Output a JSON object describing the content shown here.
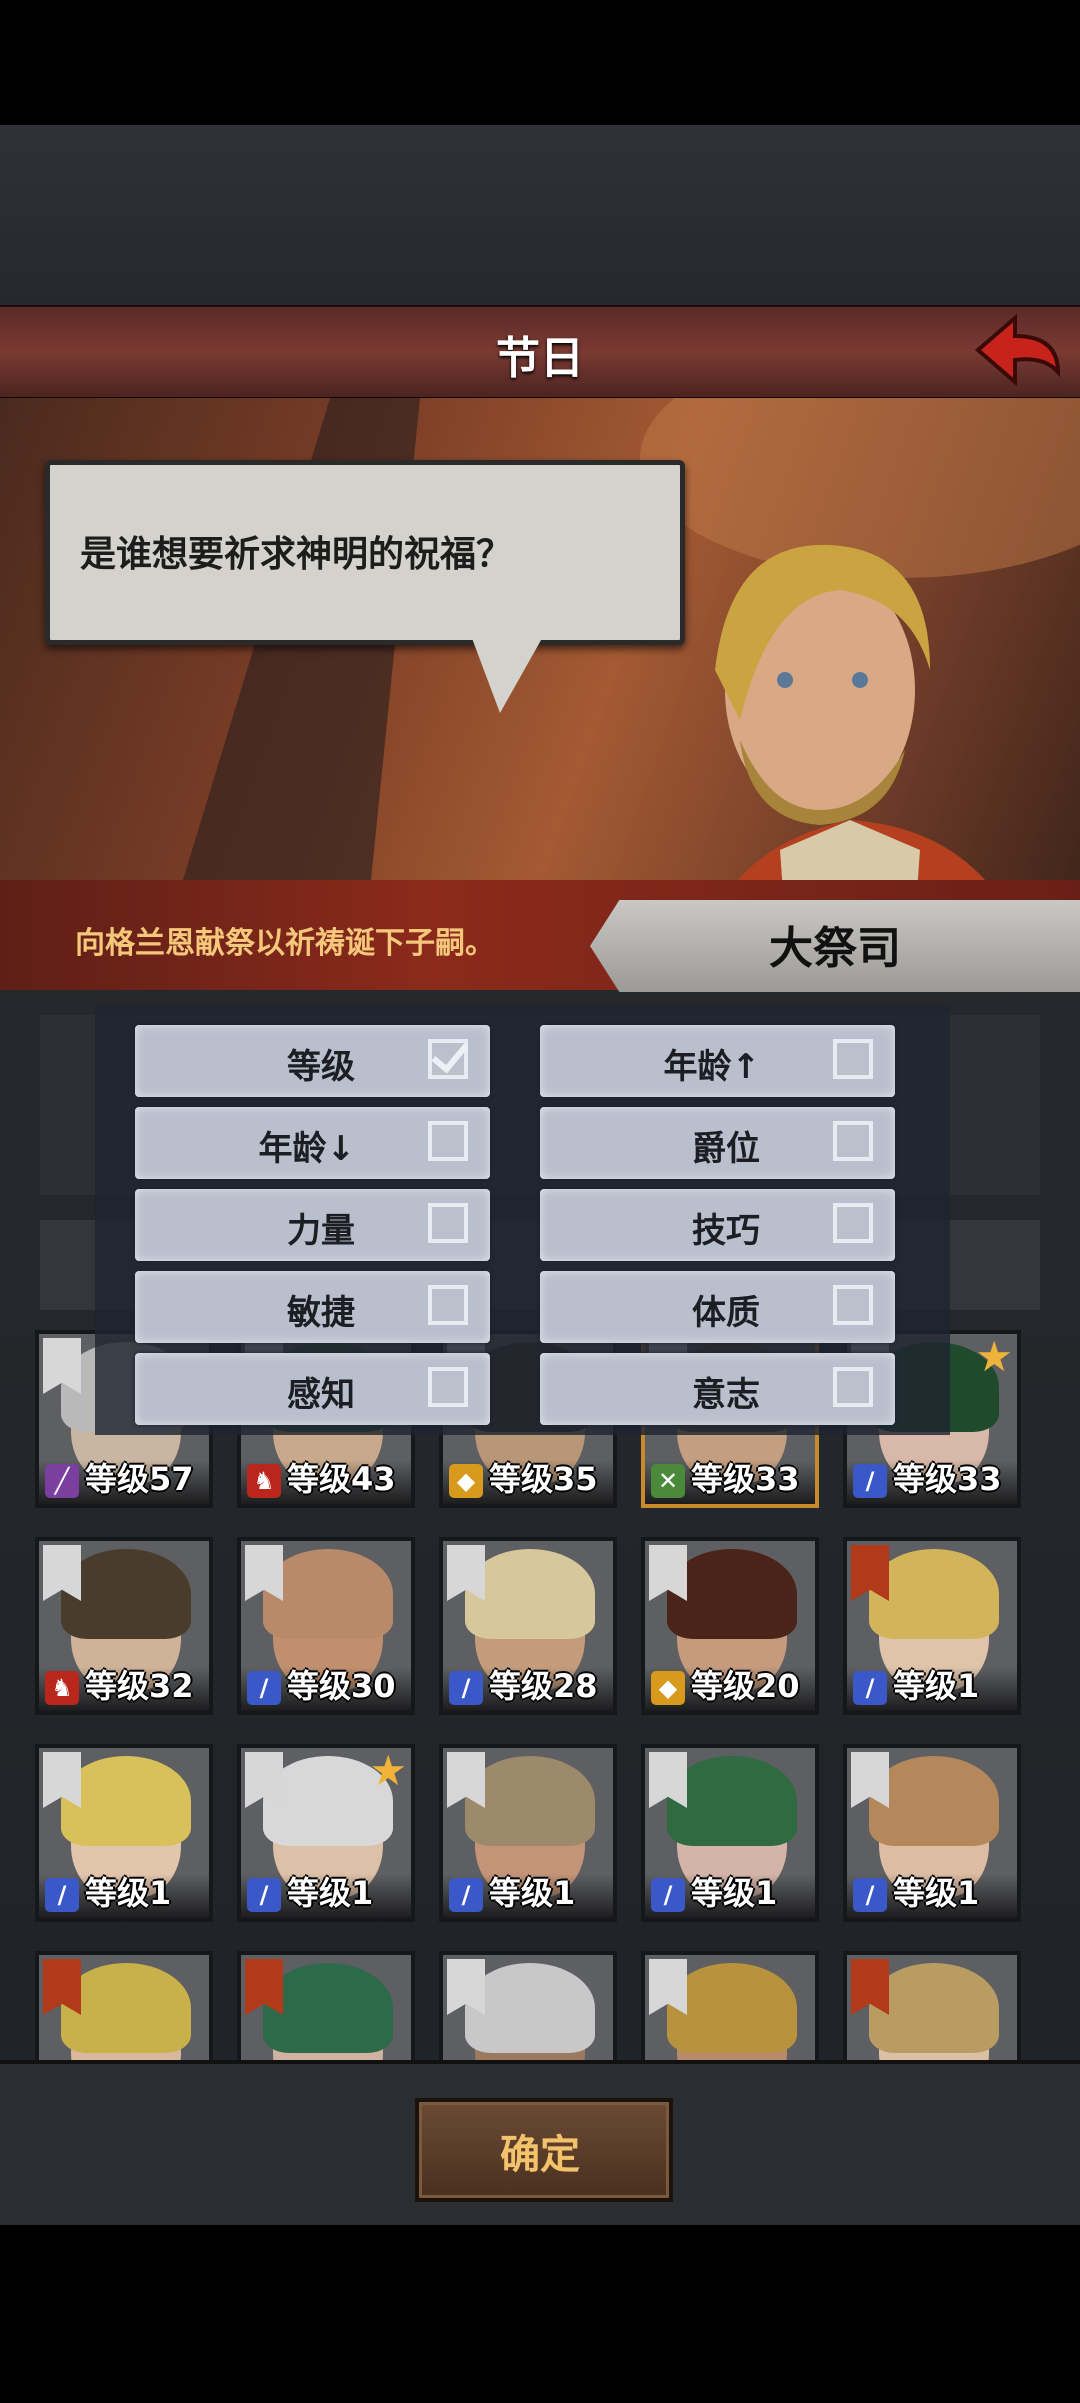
{
  "header": {
    "title": "节日"
  },
  "dialog": {
    "text": "是谁想要祈求神明的祝福？"
  },
  "info": {
    "text": "向格兰恩献祭以祈祷诞下子嗣。",
    "name": "大祭司"
  },
  "sort_options": [
    {
      "label": "等级",
      "checked": true
    },
    {
      "label": "年龄↑",
      "checked": false
    },
    {
      "label": "年龄↓",
      "checked": false
    },
    {
      "label": "爵位",
      "checked": false
    },
    {
      "label": "力量",
      "checked": false
    },
    {
      "label": "技巧",
      "checked": false
    },
    {
      "label": "敏捷",
      "checked": false
    },
    {
      "label": "体质",
      "checked": false
    },
    {
      "label": "感知",
      "checked": false
    },
    {
      "label": "意志",
      "checked": false
    }
  ],
  "characters": [
    {
      "level": "等级57",
      "class": "staff",
      "banner": "white",
      "star": false,
      "hair": "#b9b9b9",
      "skin": "#c9b6a2"
    },
    {
      "level": "等级43",
      "class": "horse",
      "banner": "white",
      "star": false,
      "hair": "#2f5a34",
      "skin": "#c8a98c"
    },
    {
      "level": "等级35",
      "class": "shield",
      "banner": "white",
      "star": false,
      "hair": "#3a3026",
      "skin": "#b89678"
    },
    {
      "level": "等级33",
      "class": "cross",
      "banner": "white",
      "star": false,
      "selected": true,
      "hair": "#5a4a36",
      "skin": "#c49e80"
    },
    {
      "level": "等级33",
      "class": "sword",
      "banner": "white",
      "star": true,
      "hair": "#1f4a2c",
      "skin": "#d8b8a8"
    },
    {
      "level": "等级32",
      "class": "horse",
      "banner": "white",
      "star": false,
      "hair": "#4a3c2c",
      "skin": "#d0b298"
    },
    {
      "level": "等级30",
      "class": "sword",
      "banner": "white",
      "star": false,
      "hair": "#b98a6a",
      "skin": "#c0906e"
    },
    {
      "level": "等级28",
      "class": "sword",
      "banner": "white",
      "star": false,
      "hair": "#d6c89a",
      "skin": "#c49c7c"
    },
    {
      "level": "等级20",
      "class": "shield",
      "banner": "white",
      "star": false,
      "hair": "#4a2418",
      "skin": "#c69a7c"
    },
    {
      "level": "等级1",
      "class": "sword",
      "banner": "red",
      "star": false,
      "hair": "#d2b45a",
      "skin": "#e0c4aa"
    },
    {
      "level": "等级1",
      "class": "sword",
      "banner": "white",
      "star": false,
      "hair": "#d8c05a",
      "skin": "#e2c6ac"
    },
    {
      "level": "等级1",
      "class": "sword",
      "banner": "white",
      "star": true,
      "hair": "#d8d8d8",
      "skin": "#dcc0a8"
    },
    {
      "level": "等级1",
      "class": "sword",
      "banner": "white",
      "star": false,
      "hair": "#9c8a6a",
      "skin": "#c49478"
    },
    {
      "level": "等级1",
      "class": "sword",
      "banner": "white",
      "star": false,
      "hair": "#2f6a40",
      "skin": "#d4b4a8"
    },
    {
      "level": "等级1",
      "class": "sword",
      "banner": "white",
      "star": false,
      "hair": "#b4885a",
      "skin": "#dcbca2"
    },
    {
      "level": "",
      "class": "",
      "banner": "red",
      "star": false,
      "hair": "#c8b04a",
      "skin": "#d8b89c"
    },
    {
      "level": "",
      "class": "",
      "banner": "red",
      "star": false,
      "hair": "#2c6a4a",
      "skin": "#cfb2a0"
    },
    {
      "level": "",
      "class": "",
      "banner": "white",
      "star": false,
      "hair": "#c8c8c8",
      "skin": "#9a7a60"
    },
    {
      "level": "",
      "class": "",
      "banner": "white",
      "star": false,
      "hair": "#b8923c",
      "skin": "#b88a6a"
    },
    {
      "level": "",
      "class": "",
      "banner": "red",
      "star": false,
      "hair": "#b89c62",
      "skin": "#dcc0a6"
    }
  ],
  "footer": {
    "confirm_label": "确定"
  },
  "colors": {
    "title_bar": "#7a3a33",
    "info_text": "#f5c77a",
    "confirm_text": "#f3c26b",
    "star": "#f0b33a"
  }
}
